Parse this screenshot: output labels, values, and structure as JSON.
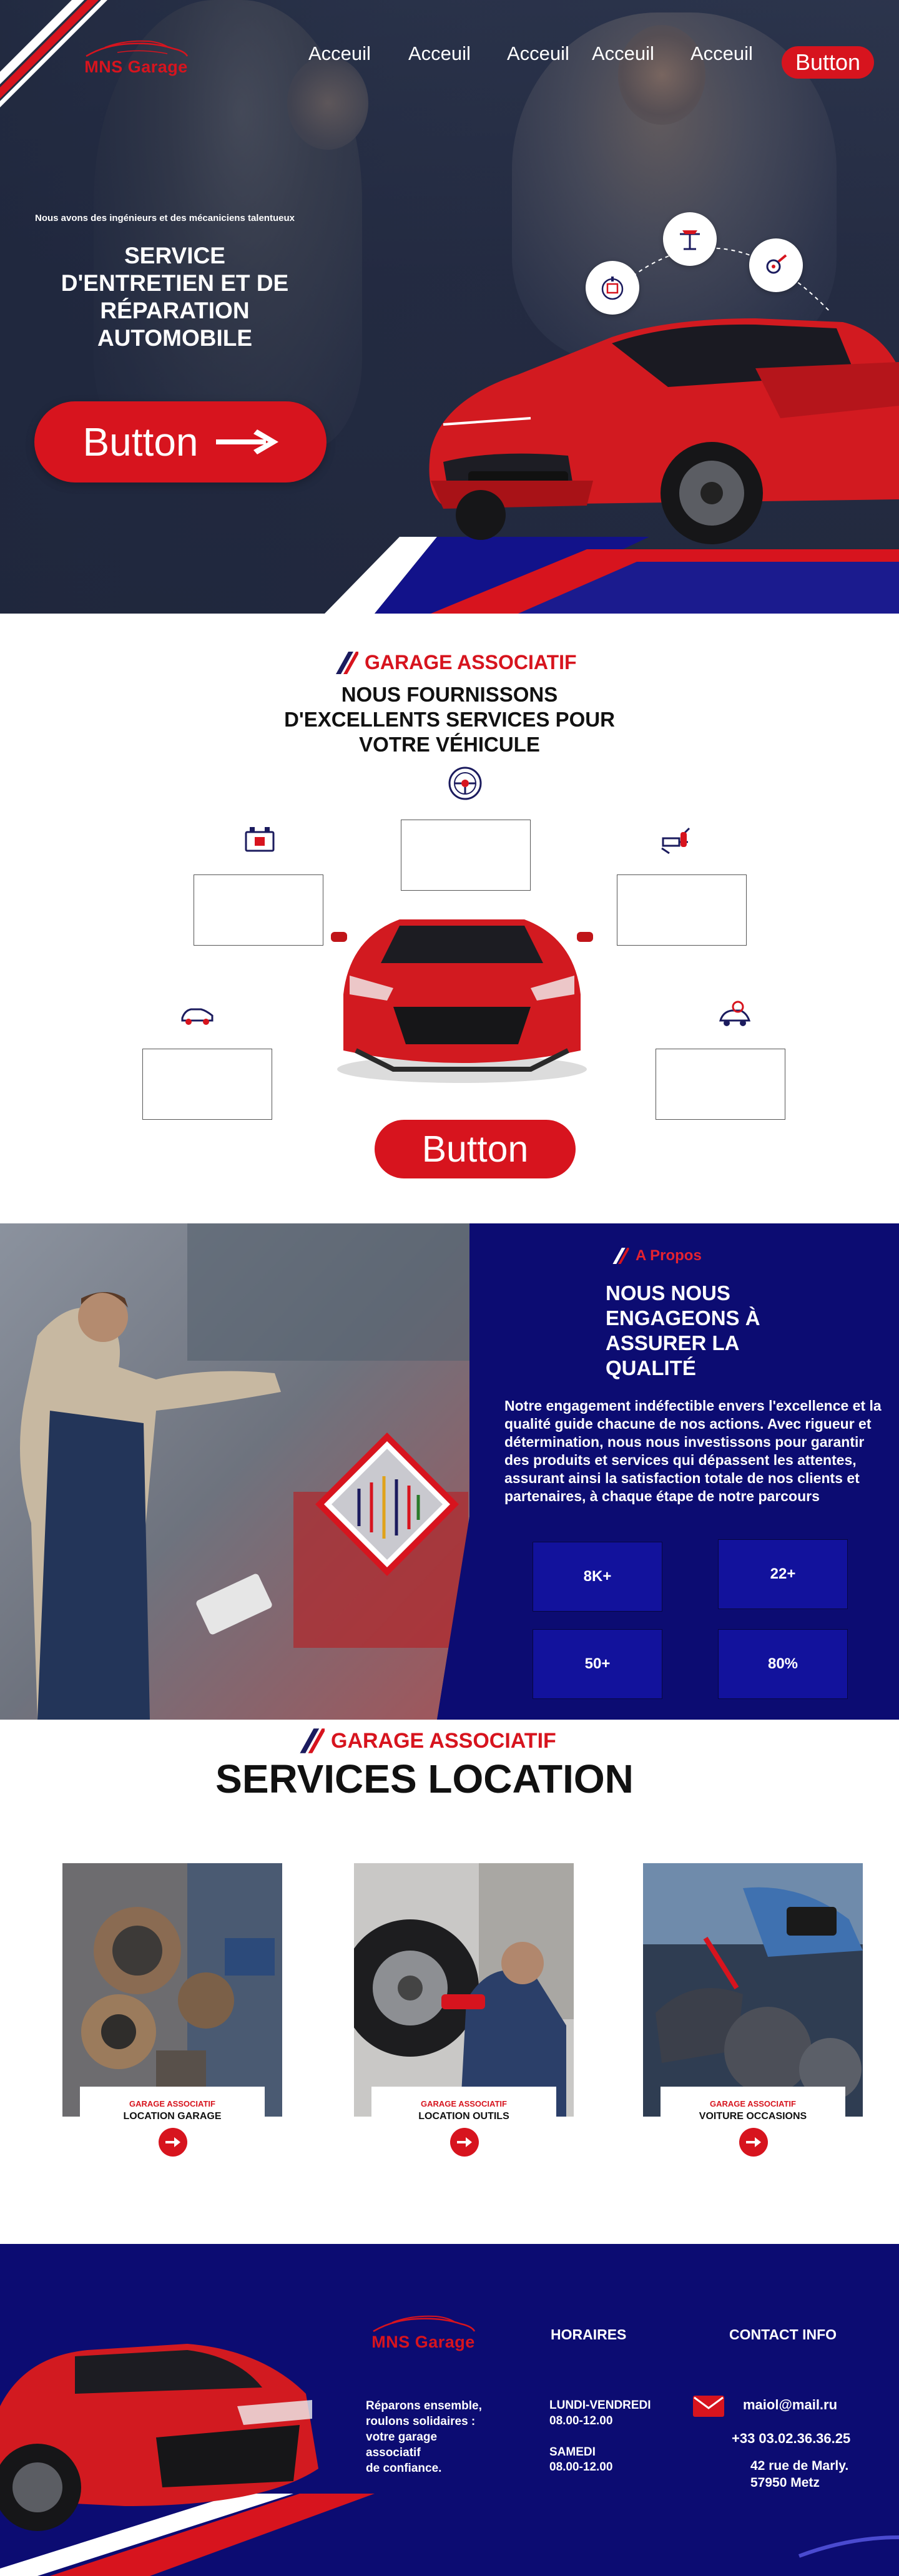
{
  "brand": {
    "name": "MNS Garage",
    "color_primary": "#d7141e",
    "color_navy": "#0c0c72"
  },
  "nav": {
    "links": [
      "Acceuil",
      "Acceuil",
      "Acceuil",
      "Acceuil",
      "Acceuil"
    ],
    "cta_label": "Button"
  },
  "hero": {
    "kicker": "Nous avons des ingénieurs et des mécaniciens talentueux",
    "title": "SERVICE D'ENTRETIEN ET DE RÉPARATION AUTOMOBILE",
    "button_label": "Button",
    "icons": [
      "battery-check-icon",
      "car-lift-icon",
      "wrench-gear-icon"
    ]
  },
  "services": {
    "eyebrow": "GARAGE ASSOCIATIF",
    "title": "NOUS FOURNISSONS D'EXCELLENTS SERVICES POUR VOTRE VÉHICULE",
    "icons": [
      "steering-wheel-icon",
      "car-battery-icon",
      "spark-plug-icon",
      "car-icon",
      "engine-repair-icon"
    ],
    "button_label": "Button"
  },
  "about": {
    "eyebrow": "A Propos",
    "title": "NOUS NOUS\n ENGAGEONS À\nASSURER LA\nQUALITÉ",
    "text": "Notre engagement indéfectible envers l'excellence et la qualité guide chacune de nos actions. Avec rigueur et détermination, nous nous investissons pour garantir des produits et services qui dépassent les attentes, assurant ainsi la satisfaction totale de nos clients et partenaires, à chaque étape de notre parcours",
    "stats": [
      "8K+",
      "22+",
      "50+",
      "80%"
    ]
  },
  "location": {
    "eyebrow": "GARAGE ASSOCIATIF",
    "title": "SERVICES LOCATION",
    "cards": [
      {
        "kicker": "GARAGE ASSOCIATIF",
        "name": "LOCATION GARAGE"
      },
      {
        "kicker": "GARAGE ASSOCIATIF",
        "name": "LOCATION OUTILS"
      },
      {
        "kicker": "GARAGE ASSOCIATIF",
        "name": "VOITURE OCCASIONS"
      }
    ]
  },
  "footer": {
    "logo_text": "MNS Garage",
    "tagline": "Réparons ensemble,\n roulons solidaires :\n votre garage\nassociatif\nde confiance.",
    "hours_title": "HORAIRES",
    "hours": [
      {
        "day": "LUNDI-VENDREDI",
        "time": "08.00-12.00"
      },
      {
        "day": "SAMEDI",
        "time": "08.00-12.00"
      }
    ],
    "contact_title": "CONTACT INFO",
    "email": "maiol@mail.ru",
    "phone": "+33 03.02.36.36.25",
    "address": "42 rue de Marly.\n57950 Metz"
  }
}
